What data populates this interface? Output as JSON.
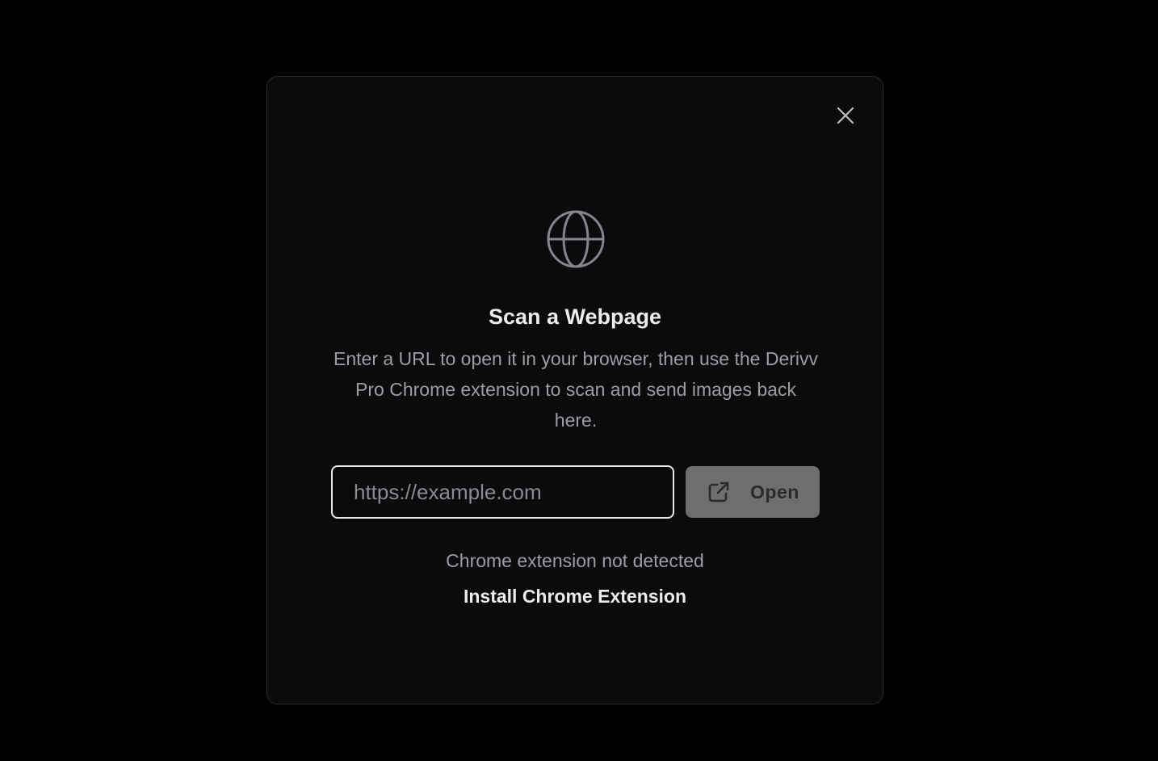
{
  "modal": {
    "title": "Scan a Webpage",
    "description": "Enter a URL to open it in your browser, then use the Derivv Pro Chrome extension to scan and send images back here.",
    "close_icon": "close-icon",
    "hero_icon": "globe-icon"
  },
  "url_input": {
    "value": "",
    "placeholder": "https://example.com"
  },
  "open_button": {
    "label": "Open",
    "icon": "external-link-icon"
  },
  "extension": {
    "status_text": "Chrome extension not detected",
    "install_label": "Install Chrome Extension"
  },
  "colors": {
    "background": "#000000",
    "modal_bg": "#0b0b0d",
    "modal_border": "#2c2c30",
    "button_bg": "#6e6e71",
    "muted_text": "#9d9da3",
    "primary_text": "#ececee"
  }
}
